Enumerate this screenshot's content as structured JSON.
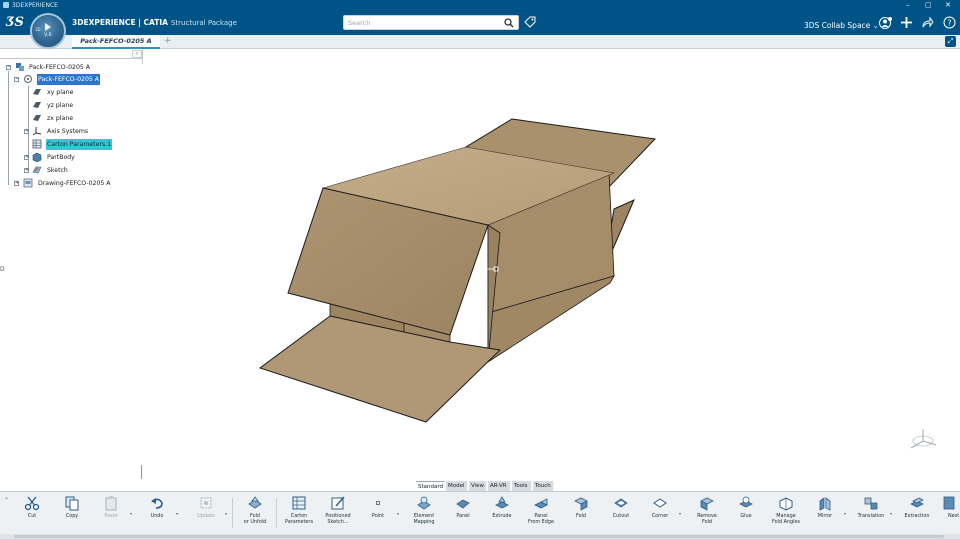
{
  "window": {
    "title": "3DEXPERIENCE"
  },
  "header": {
    "brand_bold": "3DEXPERIENCE",
    "brand_app": " | CATIA",
    "brand_role": "Structural Package",
    "search_placeholder": "Search",
    "collab_space": "3DS Collab Space ⌄"
  },
  "compass": {
    "version": "V,R"
  },
  "tabs": {
    "active": "Pack-FEFCO-0205 A",
    "add": "+"
  },
  "tree": {
    "root": "Pack-FEFCO-0205 A",
    "part": "Pack-FEFCO-0205 A",
    "items": [
      {
        "label": "xy plane"
      },
      {
        "label": "yz plane"
      },
      {
        "label": "zx plane"
      },
      {
        "label": "Axis Systems"
      },
      {
        "label": "Carton Parameters.1"
      },
      {
        "label": "PartBody"
      },
      {
        "label": "Sketch"
      }
    ],
    "drawing": "Drawing-FEFCO-0205 A"
  },
  "section_tabs": [
    {
      "label": "Standard",
      "active": true
    },
    {
      "label": "Model",
      "active": false
    },
    {
      "label": "View",
      "active": false
    },
    {
      "label": "AR-VR",
      "active": false
    },
    {
      "label": "Tools",
      "active": false
    },
    {
      "label": "Touch",
      "active": false
    }
  ],
  "commands": {
    "cut": "Cut",
    "copy": "Copy",
    "paste": "Paste",
    "undo": "Undo",
    "update": "Update",
    "fold_unfold_1": "Fold",
    "fold_unfold_2": "or Unfold",
    "carton_params_1": "Carton",
    "carton_params_2": "Parameters",
    "pos_sketch_1": "Positioned",
    "pos_sketch_2": "Sketch...",
    "point": "Point",
    "elem_map_1": "Element",
    "elem_map_2": "Mapping",
    "panel": "Panel",
    "extrude": "Extrude",
    "panel_edge_1": "Panel",
    "panel_edge_2": "From Edge",
    "fold": "Fold",
    "cutout": "Cutout",
    "corner": "Corner",
    "remove_fold_1": "Remove",
    "remove_fold_2": "Fold",
    "glue": "Glue",
    "manage_fold_1": "Manage",
    "manage_fold_2": "Fold Angles",
    "mirror": "Mirror",
    "translation": "Translation",
    "extraction": "Extraction",
    "nest": "Nest"
  },
  "colors": {
    "header_blue": "#005386",
    "selection_blue": "#2b76d3",
    "highlight_cyan": "#33c7d4",
    "cardboard": "#b8a07a"
  }
}
